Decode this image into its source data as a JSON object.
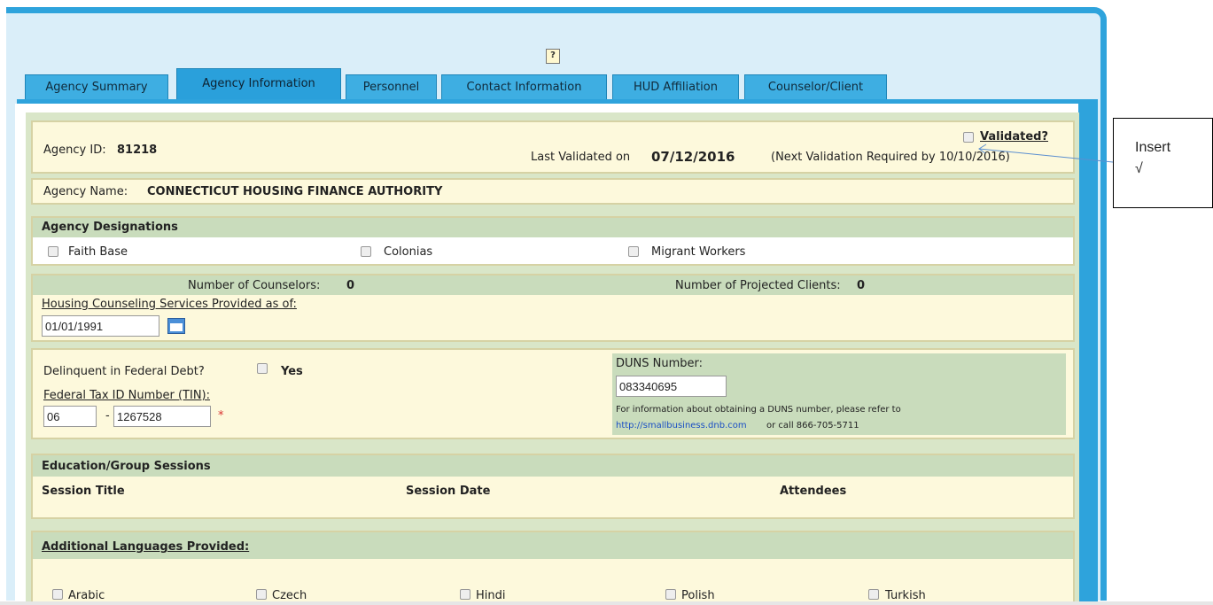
{
  "tabs": [
    {
      "label": "Agency Summary",
      "active": false
    },
    {
      "label": "Agency Information",
      "active": true
    },
    {
      "label": "Personnel",
      "active": false
    },
    {
      "label": "Contact Information",
      "active": false
    },
    {
      "label": "HUD Affiliation",
      "active": false
    },
    {
      "label": "Counselor/Client",
      "active": false
    }
  ],
  "help_icon": "help-notepad-icon",
  "agency": {
    "id_label": "Agency ID:",
    "id_value": "81218",
    "validated_label": "Validated?",
    "last_validated_prefix": "Last Validated on",
    "last_validated_date": "07/12/2016",
    "next_validation": "(Next Validation Required by 10/10/2016)",
    "name_label": "Agency Name:",
    "name_value": "CONNECTICUT HOUSING FINANCE AUTHORITY"
  },
  "designations": {
    "header": "Agency Designations",
    "options": [
      "Faith Base",
      "Colonias",
      "Migrant Workers"
    ]
  },
  "counts": {
    "counselors_label": "Number of Counselors:",
    "counselors_value": "0",
    "projected_label": "Number of Projected Clients:",
    "projected_value": "0",
    "services_label": "Housing Counseling Services Provided as of:",
    "services_date": "01/01/1991"
  },
  "federal": {
    "delinquent_label": "Delinquent in Federal Debt?",
    "yes_label": "Yes",
    "tin_label": "Federal Tax ID Number (TIN):",
    "tin_prefix": "06",
    "tin_dash": "-",
    "tin_number": "1267528",
    "required_mark": "*",
    "duns_label": "DUNS Number:",
    "duns_value": "083340695",
    "duns_info_line1": "For information about obtaining a DUNS number, please refer to",
    "duns_link": "http://smallbusiness.dnb.com",
    "duns_info_line2": "or call 866-705-5711"
  },
  "education": {
    "header": "Education/Group Sessions",
    "columns": [
      "Session Title",
      "Session Date",
      "Attendees"
    ]
  },
  "languages": {
    "header": "Additional Languages Provided:",
    "options": [
      "Arabic",
      "Czech",
      "Hindi",
      "Polish",
      "Turkish"
    ]
  },
  "callout": {
    "line1": "Insert",
    "line2": "√"
  }
}
